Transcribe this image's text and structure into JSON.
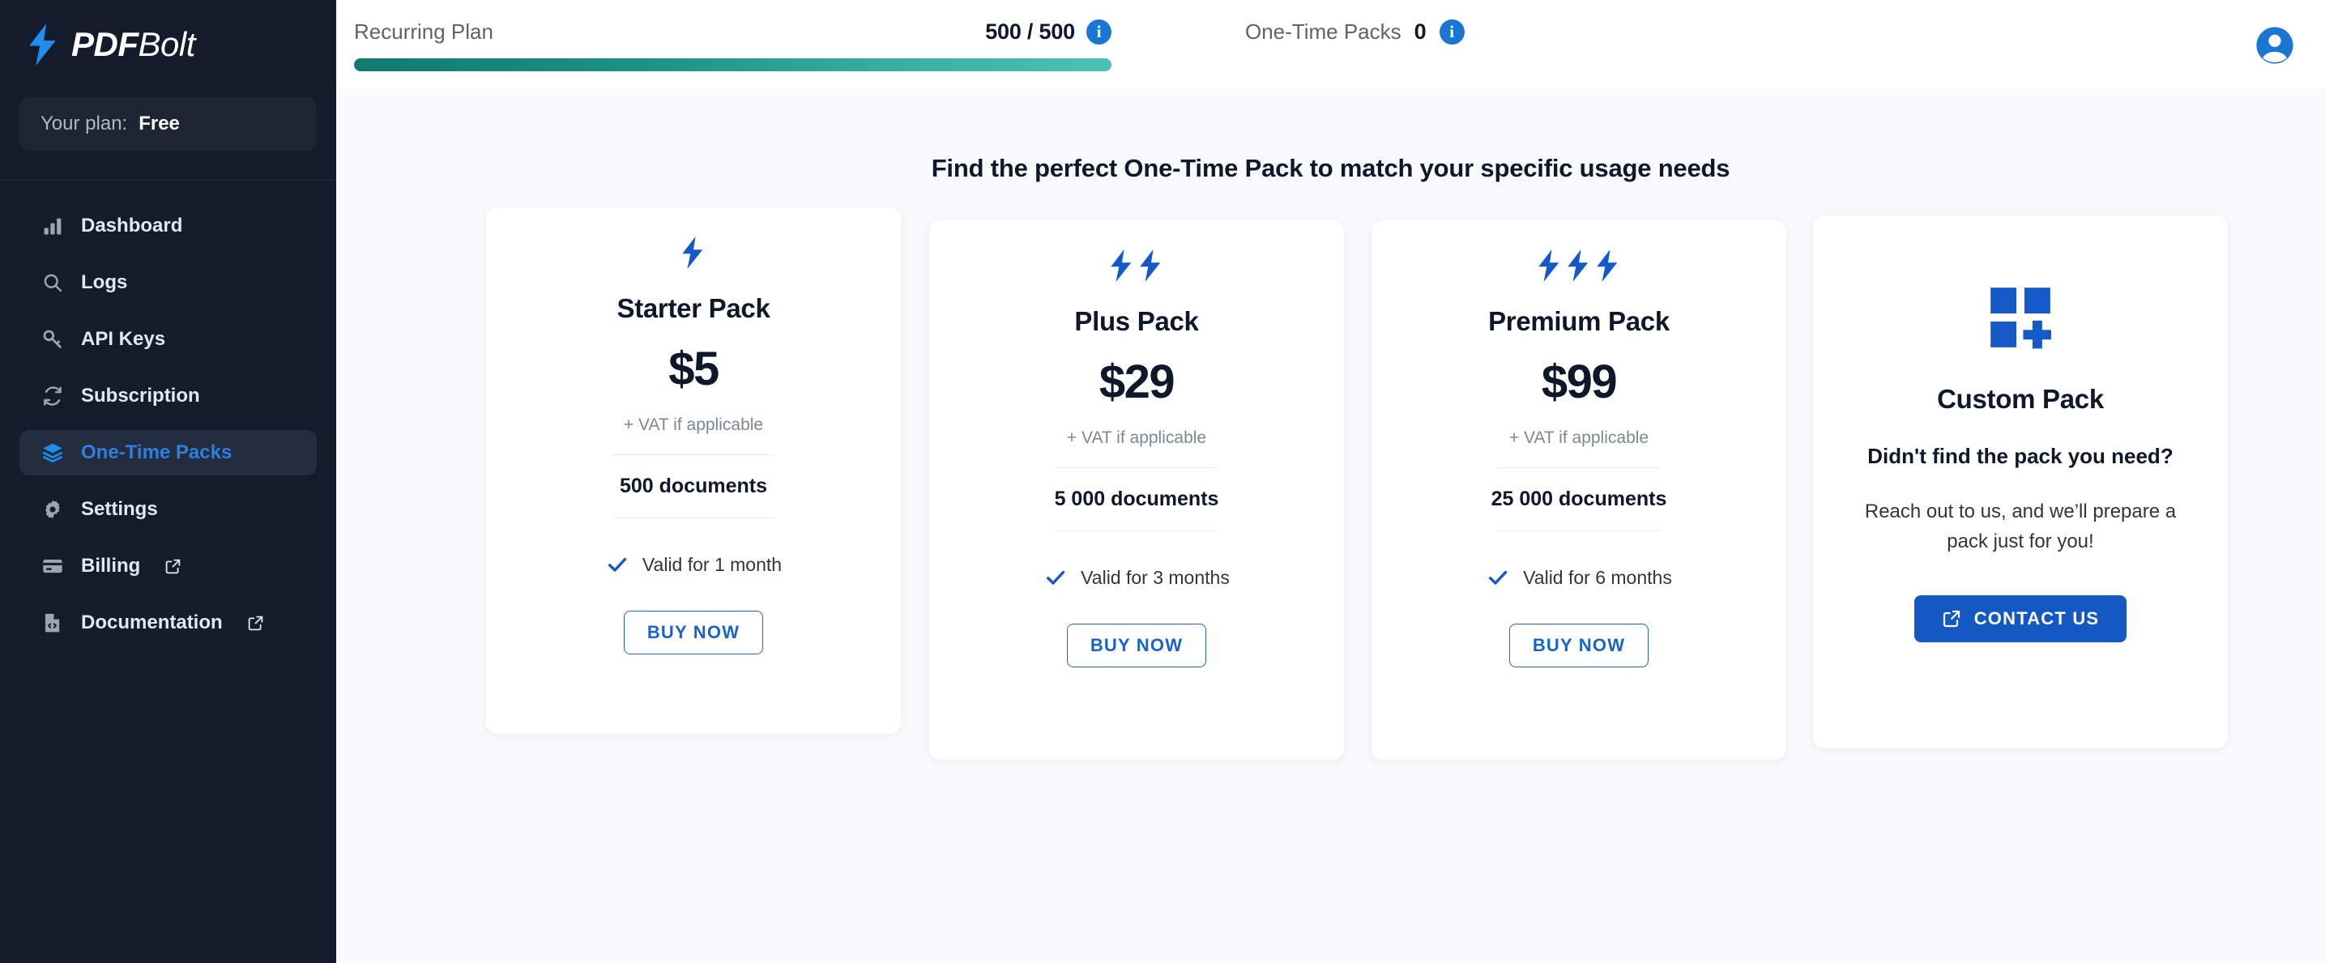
{
  "brand": {
    "name_bold": "PDF",
    "name_light": "Bolt",
    "icon": "lightning-bolt-icon"
  },
  "sidebar": {
    "plan_label": "Your plan:",
    "plan_value": "Free",
    "items": [
      {
        "label": "Dashboard",
        "icon": "bar-chart-icon",
        "active": false,
        "external": false
      },
      {
        "label": "Logs",
        "icon": "search-icon",
        "active": false,
        "external": false
      },
      {
        "label": "API Keys",
        "icon": "key-icon",
        "active": false,
        "external": false
      },
      {
        "label": "Subscription",
        "icon": "refresh-icon",
        "active": false,
        "external": false
      },
      {
        "label": "One-Time Packs",
        "icon": "layers-icon",
        "active": true,
        "external": false
      },
      {
        "label": "Settings",
        "icon": "gear-icon",
        "active": false,
        "external": false
      },
      {
        "label": "Billing",
        "icon": "credit-card-icon",
        "active": false,
        "external": true
      },
      {
        "label": "Documentation",
        "icon": "file-code-icon",
        "active": false,
        "external": true
      }
    ]
  },
  "topbar": {
    "recurring_label": "Recurring Plan",
    "recurring_count": "500 / 500",
    "recurring_progress_percent": 100,
    "recurring_info_icon": "info-icon",
    "onetime_label": "One-Time Packs",
    "onetime_count": "0",
    "onetime_info_icon": "info-icon",
    "avatar_icon": "account-circle-icon",
    "progress_color_start": "#11796e",
    "progress_color_end": "#49c2b2"
  },
  "main": {
    "headline": "Find the perfect One-Time Pack to match your specific usage needs",
    "packs": [
      {
        "name": "Starter Pack",
        "bolts": 1,
        "price": "$5",
        "vat_note": "+ VAT if applicable",
        "documents": "500 documents",
        "validity": "Valid for 1 month",
        "check_icon": "check-icon",
        "cta": "BUY NOW"
      },
      {
        "name": "Plus Pack",
        "bolts": 2,
        "price": "$29",
        "vat_note": "+ VAT if applicable",
        "documents": "5 000 documents",
        "validity": "Valid for 3 months",
        "check_icon": "check-icon",
        "cta": "BUY NOW"
      },
      {
        "name": "Premium Pack",
        "bolts": 3,
        "price": "$99",
        "vat_note": "+ VAT if applicable",
        "documents": "25 000 documents",
        "validity": "Valid for 6 months",
        "check_icon": "check-icon",
        "cta": "BUY NOW"
      }
    ],
    "custom_pack": {
      "icon": "grid-plus-icon",
      "title": "Custom Pack",
      "subtitle": "Didn't find the pack you need?",
      "body": "Reach out to us, and we’ll prepare a pack just for you!",
      "cta": "CONTACT US",
      "cta_icon": "external-link-icon"
    }
  },
  "colors": {
    "accent": "#1458c4",
    "sidebar_bg": "#141b2b",
    "page_bg": "#f7f9fb",
    "bolt_blue": "#1459c8"
  }
}
